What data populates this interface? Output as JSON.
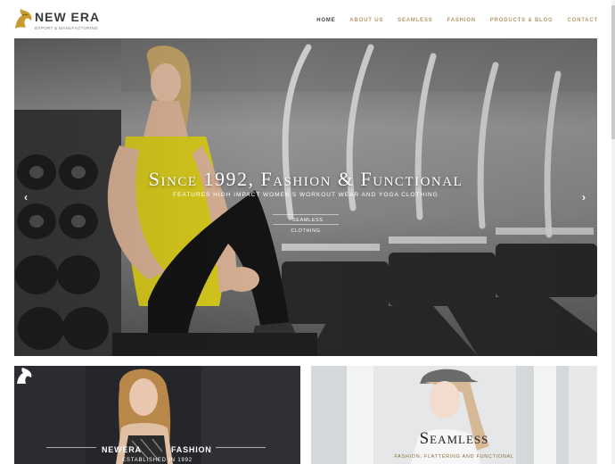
{
  "header": {
    "logo_title": "NEW ERA",
    "logo_subtitle": "EXPORT & MANUFACTURING"
  },
  "nav": {
    "items": [
      {
        "label": "HOME",
        "active": true
      },
      {
        "label": "ABOUT US",
        "active": false
      },
      {
        "label": "SEAMLESS",
        "active": false
      },
      {
        "label": "FASHION",
        "active": false
      },
      {
        "label": "PRODUCTS & BLOG",
        "active": false
      },
      {
        "label": "CONTACT",
        "active": false
      }
    ]
  },
  "hero": {
    "title": "Since 1992, Fashion & Functional",
    "subtitle": "Features high impact women's workout wear and yoga clothing",
    "button_label": "· Seamless Clothing",
    "prev_icon": "chevron-left-icon",
    "next_icon": "chevron-right-icon"
  },
  "tiles": {
    "left": {
      "brand_left": "NEWERA",
      "brand_right": "FASHION",
      "tagline": "ESTABLISHED IN 1992"
    },
    "right": {
      "title": "Seamless",
      "subtitle": "Fashion, Flattering and Functional"
    }
  },
  "colors": {
    "accent": "#b29a6c",
    "nav_active": "#444444"
  }
}
